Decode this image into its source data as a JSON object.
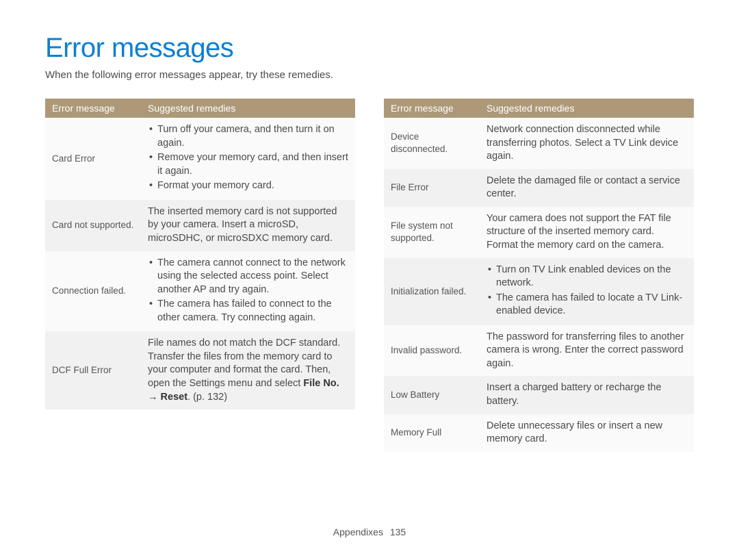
{
  "title": "Error messages",
  "intro": "When the following error messages appear, try these remedies.",
  "headers": {
    "error": "Error message",
    "remedy": "Suggested remedies"
  },
  "left": [
    {
      "name": "Card Error",
      "bullets": [
        "Turn off your camera, and then turn it on again.",
        "Remove your memory card, and then insert it again.",
        "Format your memory card."
      ]
    },
    {
      "name": "Card not supported.",
      "text": "The inserted memory card is not supported by your camera. Insert a microSD, microSDHC, or microSDXC memory card."
    },
    {
      "name": "Connection failed.",
      "bullets": [
        "The camera cannot connect to the network using the selected access point. Select another AP and try again.",
        "The camera has failed to connect to the other camera. Try connecting again."
      ]
    },
    {
      "name": "DCF Full Error",
      "text_pre": "File names do not match the DCF standard. Transfer the files from the memory card to your computer and format the card. Then, open the Settings menu and select ",
      "text_bold": "File No. → Reset",
      "text_post": ". (p. 132)"
    }
  ],
  "right": [
    {
      "name": "Device disconnected.",
      "text": "Network connection disconnected while transferring photos. Select a TV Link device again."
    },
    {
      "name": "File Error",
      "text": "Delete the damaged file or contact a service center."
    },
    {
      "name": "File system not supported.",
      "text": "Your camera does not support the FAT file structure of the inserted memory card. Format the memory card on the camera."
    },
    {
      "name": "Initialization failed.",
      "bullets": [
        "Turn on TV Link enabled devices on the network.",
        "The camera has failed to locate a TV Link-enabled device."
      ]
    },
    {
      "name": "Invalid password.",
      "text": "The password for transferring files to another camera is wrong. Enter the correct password again."
    },
    {
      "name": "Low Battery",
      "text": "Insert a charged battery or recharge the battery."
    },
    {
      "name": "Memory Full",
      "text": "Delete unnecessary files or insert a new memory card."
    }
  ],
  "footer": {
    "section": "Appendixes",
    "page": "135"
  }
}
